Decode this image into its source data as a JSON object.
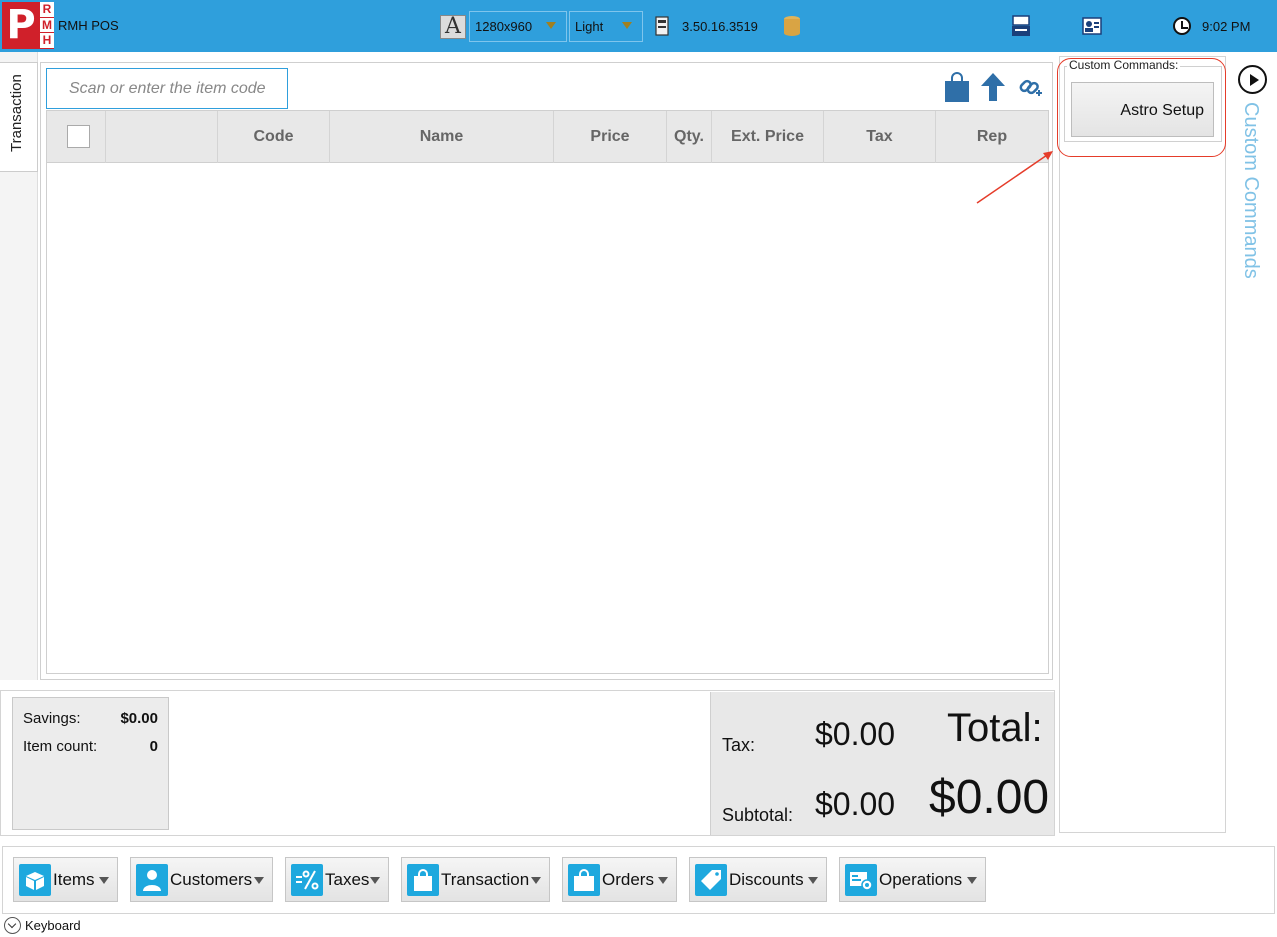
{
  "header": {
    "logo_letter": "P",
    "logo_letters": [
      "R",
      "M",
      "H"
    ],
    "app_title": "RMH POS",
    "font_icon_letter": "A",
    "resolution": "1280x960",
    "theme": "Light",
    "version": "3.50.16.3519",
    "time": "9:02 PM"
  },
  "left_tab": {
    "label": "Transaction"
  },
  "scan": {
    "placeholder": "Scan or enter the item code"
  },
  "grid": {
    "columns": [
      "",
      "Code",
      "Name",
      "Price",
      "Qty.",
      "Ext. Price",
      "Tax",
      "Rep"
    ]
  },
  "custom_commands": {
    "legend": "Custom Commands:",
    "button": "Astro Setup",
    "side_label": "Custom Commands"
  },
  "summary": {
    "savings_label": "Savings:",
    "savings_value": "$0.00",
    "item_count_label": "Item count:",
    "item_count_value": "0"
  },
  "totals": {
    "tax_label": "Tax:",
    "tax_value": "$0.00",
    "subtotal_label": "Subtotal:",
    "subtotal_value": "$0.00",
    "total_label": "Total:",
    "total_value": "$0.00"
  },
  "toolbar": {
    "items": [
      "Items",
      "Customers",
      "Taxes",
      "Transaction",
      "Orders",
      "Discounts",
      "Operations"
    ]
  },
  "keyboard_label": "Keyboard",
  "colors": {
    "accent": "#2f9fdc",
    "logo_red": "#d0202a",
    "highlight": "#e53c2a"
  }
}
